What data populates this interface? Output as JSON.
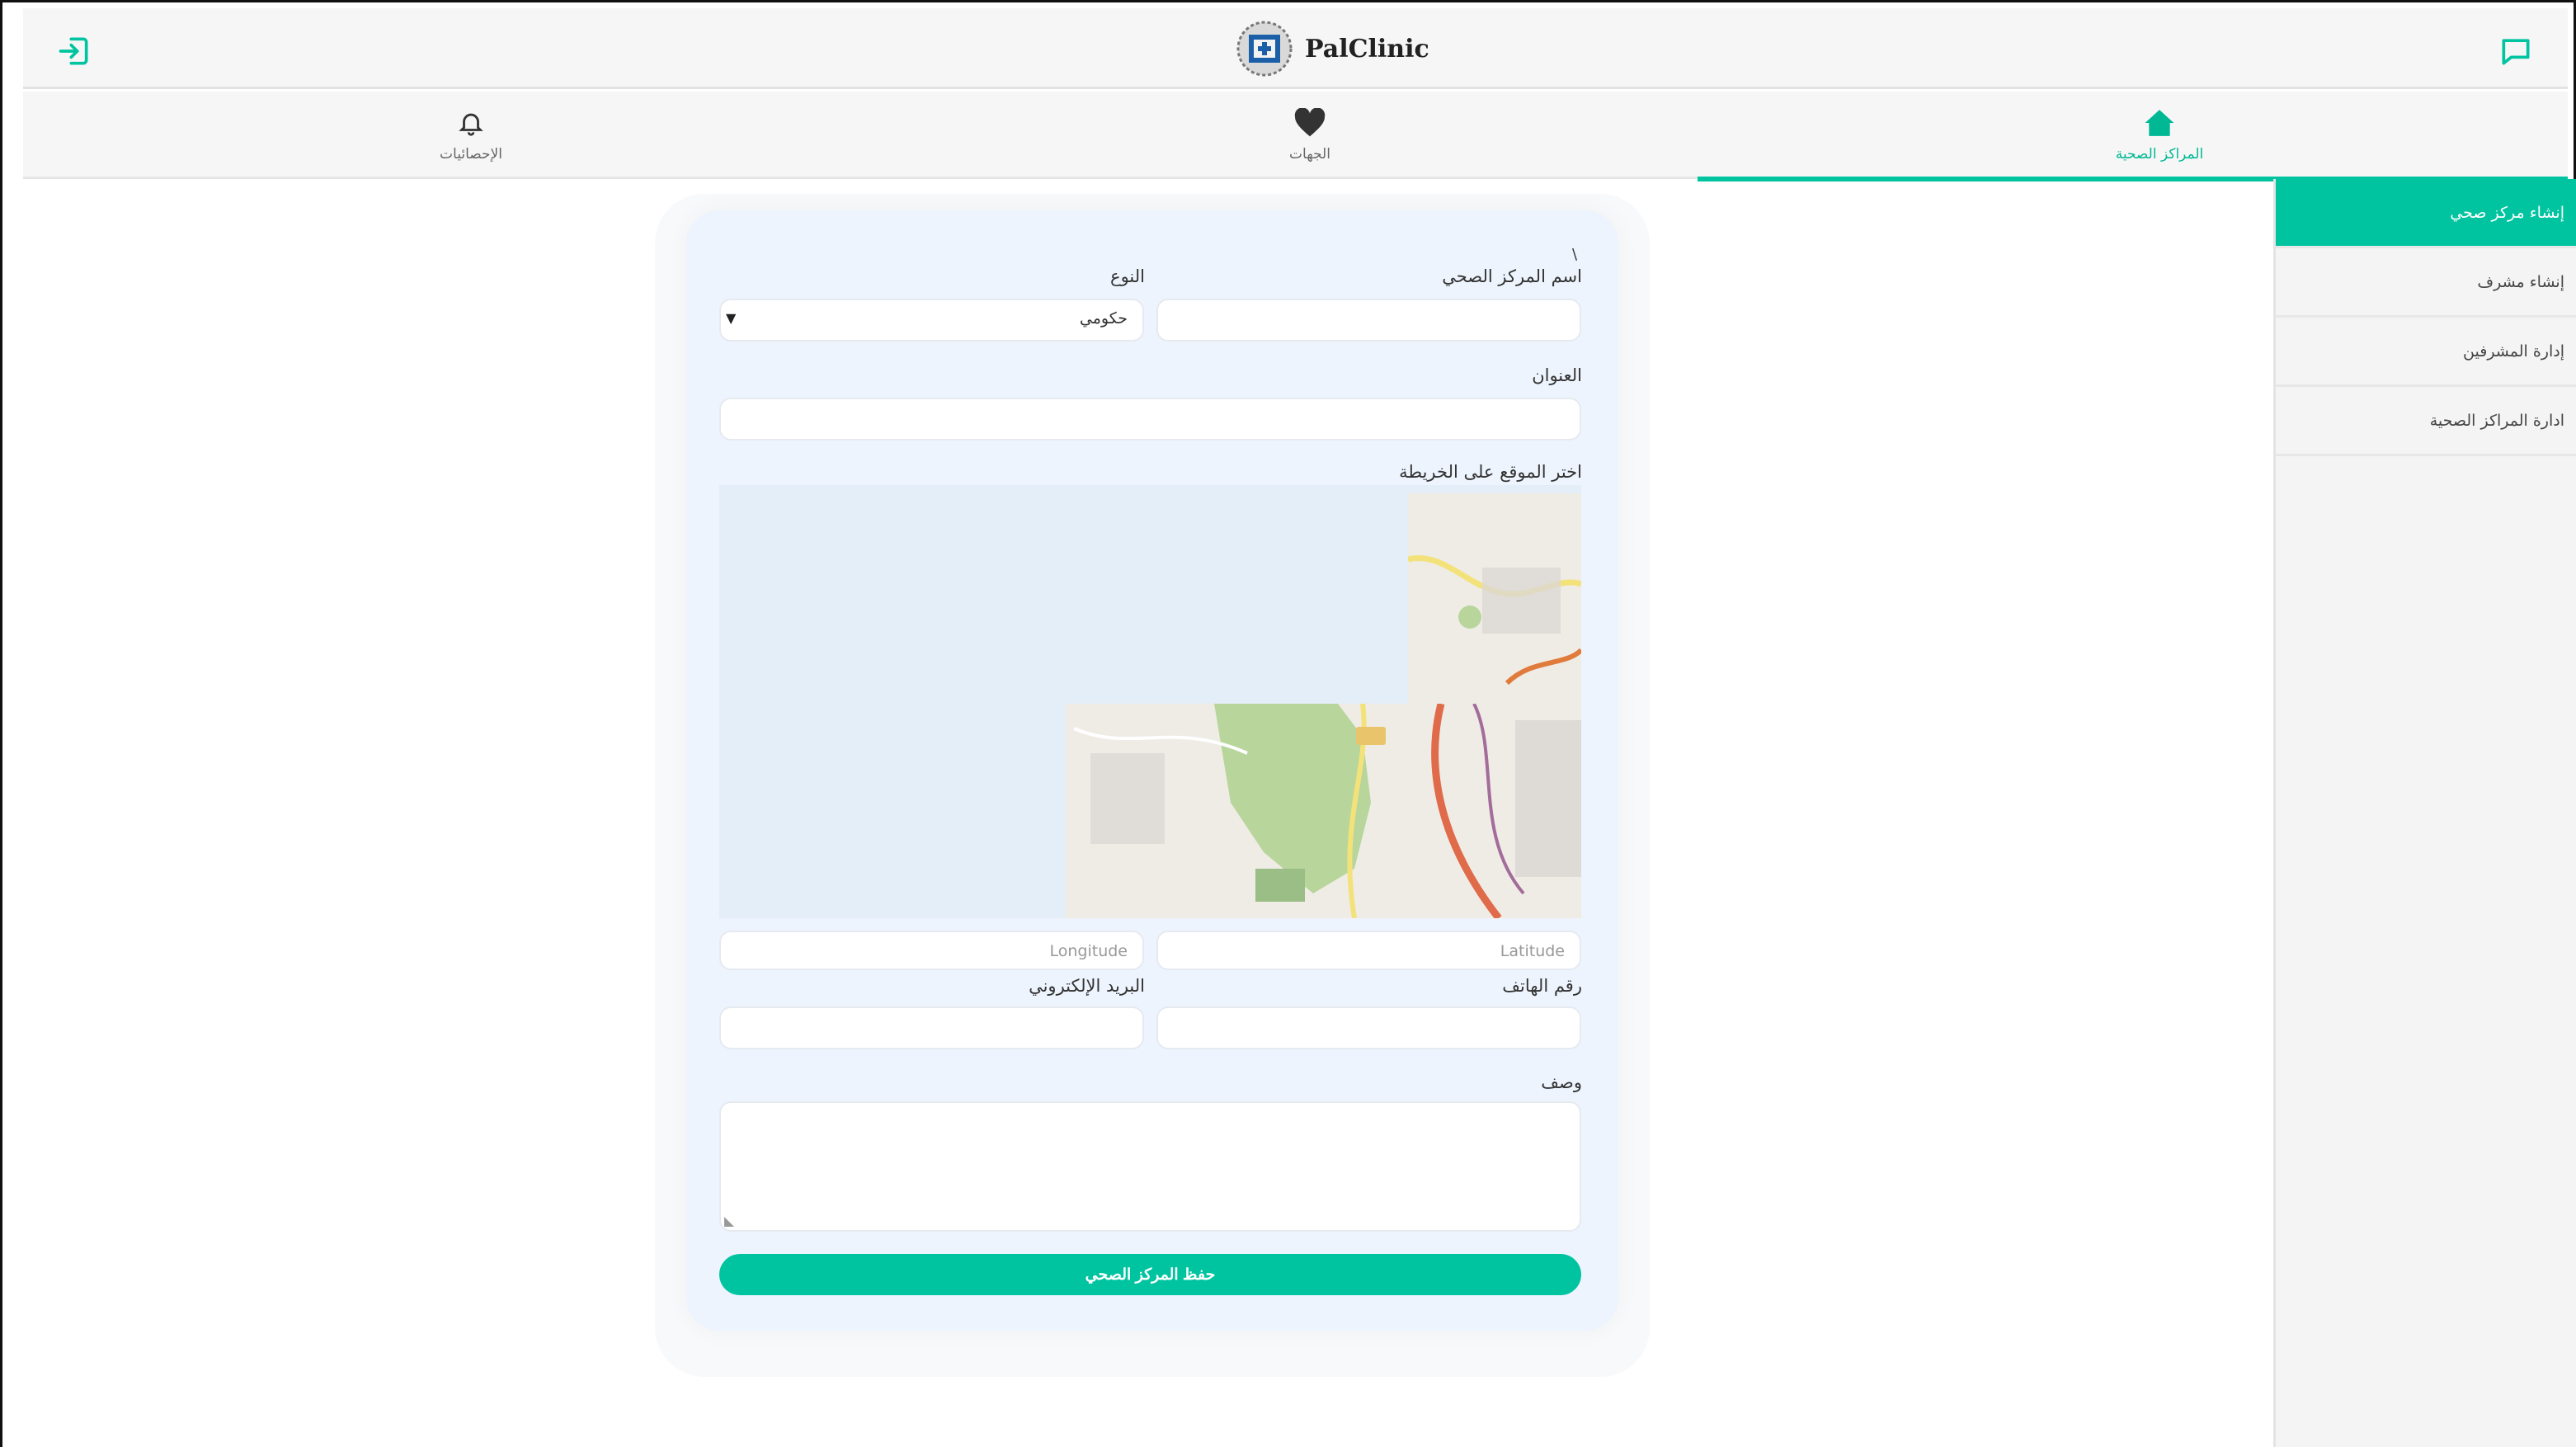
{
  "app": {
    "brand": "PalClinic"
  },
  "nav": {
    "tabs": [
      {
        "label": "الإحصائيات",
        "icon": "bell-icon"
      },
      {
        "label": "الجهات",
        "icon": "heart-icon"
      },
      {
        "label": "المراكز الصحية",
        "icon": "home-icon",
        "active": true
      }
    ]
  },
  "sidebar": {
    "items": [
      {
        "label": "إنشاء مركز صحي",
        "active": true
      },
      {
        "label": "إنشاء مشرف"
      },
      {
        "label": "إدارة المشرفين"
      },
      {
        "label": "ادارة المراكز الصحية"
      }
    ]
  },
  "form": {
    "mark": "\\",
    "name_label": "اسم المركز الصحي",
    "type_label": "النوع",
    "type_value": "حكومي",
    "address_label": "العنوان",
    "map_label": "اختر الموقع على الخريطة",
    "latitude_placeholder": "Latitude",
    "longitude_placeholder": "Longitude",
    "phone_label": "رقم الهاتف",
    "email_label": "البريد الإلكتروني",
    "description_label": "وصف",
    "save_label": "حفظ المركز الصحي"
  },
  "colors": {
    "accent": "#00c4a0",
    "card": "#eef4fd",
    "map_water": "#e4eef8"
  }
}
